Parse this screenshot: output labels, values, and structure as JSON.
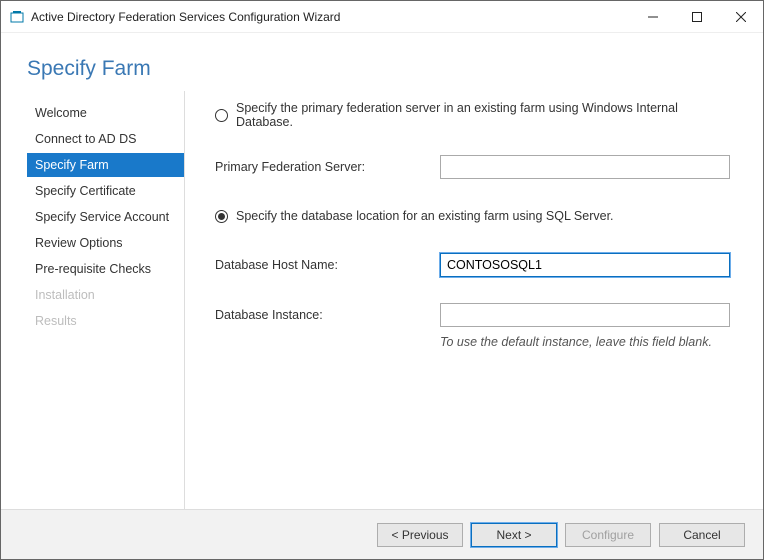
{
  "window": {
    "title": "Active Directory Federation Services Configuration Wizard"
  },
  "heading": "Specify Farm",
  "sidebar": {
    "items": [
      {
        "label": "Welcome",
        "state": "normal"
      },
      {
        "label": "Connect to AD DS",
        "state": "normal"
      },
      {
        "label": "Specify Farm",
        "state": "selected"
      },
      {
        "label": "Specify Certificate",
        "state": "normal"
      },
      {
        "label": "Specify Service Account",
        "state": "normal"
      },
      {
        "label": "Review Options",
        "state": "normal"
      },
      {
        "label": "Pre-requisite Checks",
        "state": "normal"
      },
      {
        "label": "Installation",
        "state": "disabled"
      },
      {
        "label": "Results",
        "state": "disabled"
      }
    ]
  },
  "form": {
    "option_primary_label": "Specify the primary federation server in an existing farm using Windows Internal Database.",
    "primary_server_label": "Primary Federation Server:",
    "primary_server_value": "",
    "option_sql_label": "Specify the database location for an existing farm using SQL Server.",
    "selected_option": "sql",
    "db_host_label": "Database Host Name:",
    "db_host_value": "CONTOSOSQL1",
    "db_instance_label": "Database Instance:",
    "db_instance_value": "",
    "db_instance_hint": "To use the default instance, leave this field blank."
  },
  "footer": {
    "previous": "< Previous",
    "next": "Next >",
    "configure": "Configure",
    "cancel": "Cancel"
  }
}
